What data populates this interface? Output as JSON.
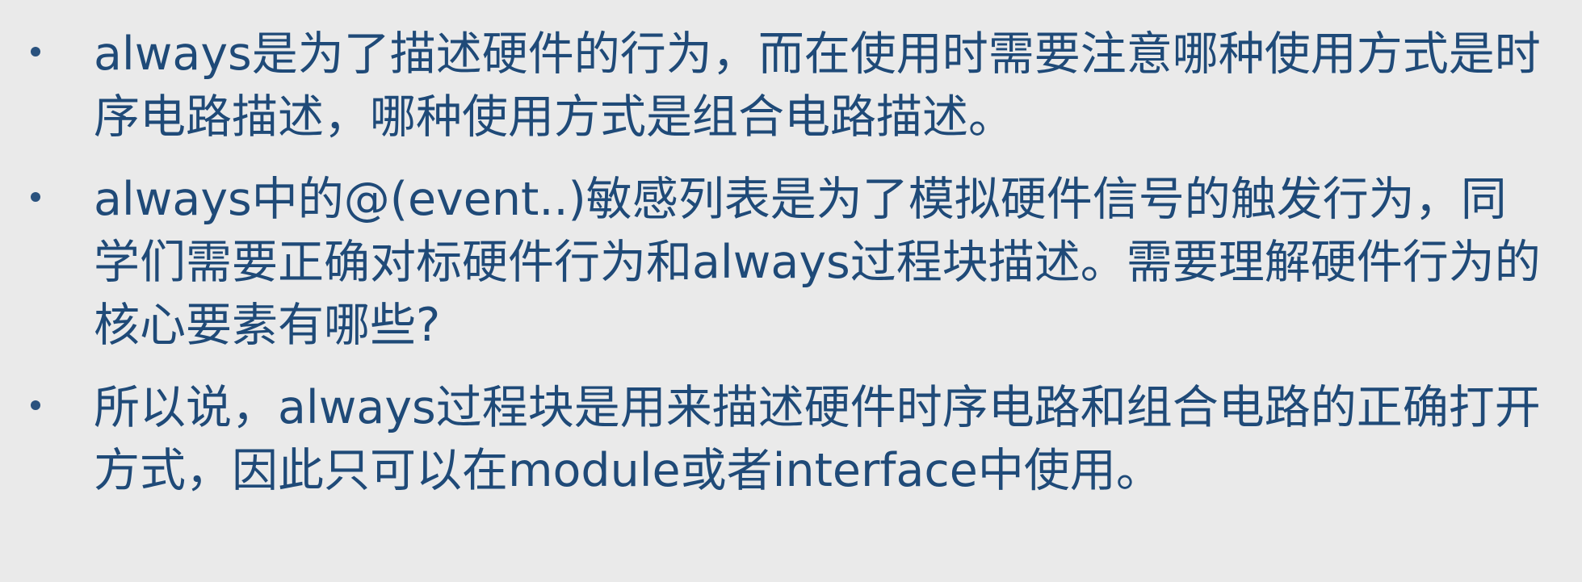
{
  "bullets": [
    {
      "text": "always是为了描述硬件的行为，而在使用时需要注意哪种使用方式是时序电路描述，哪种使用方式是组合电路描述。"
    },
    {
      "text": "always中的@(event..)敏感列表是为了模拟硬件信号的触发行为，同学们需要正确对标硬件行为和always过程块描述。需要理解硬件行为的核心要素有哪些?"
    },
    {
      "text": "所以说，always过程块是用来描述硬件时序电路和组合电路的正确打开方式，因此只可以在module或者interface中使用。"
    }
  ]
}
